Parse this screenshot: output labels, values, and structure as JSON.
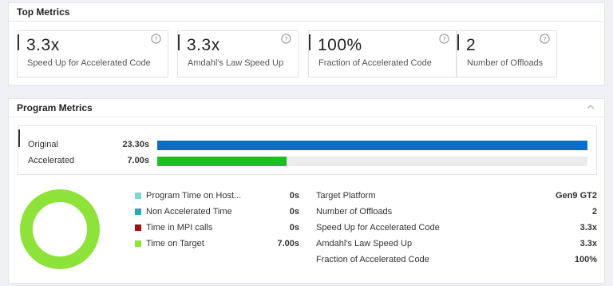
{
  "top_metrics": {
    "title": "Top Metrics",
    "cards": [
      {
        "value": "3.3x",
        "label": "Speed Up for Accelerated Code"
      },
      {
        "value": "3.3x",
        "label": "Amdahl's Law Speed Up"
      },
      {
        "value": "100%",
        "label": "Fraction of Accelerated Code"
      },
      {
        "value": "2",
        "label": "Number of Offloads"
      }
    ]
  },
  "program_metrics": {
    "title": "Program Metrics",
    "bars": [
      {
        "label": "Original",
        "value": "23.30s",
        "seconds": 23.3,
        "color": "#0a6ec8"
      },
      {
        "label": "Accelerated",
        "value": "7.00s",
        "seconds": 7.0,
        "color": "#19c01e"
      }
    ],
    "legend": [
      {
        "label": "Program Time on Host...",
        "value": "0s",
        "color": "#7fd6cc"
      },
      {
        "label": "Non Accelerated Time",
        "value": "0s",
        "color": "#26a7b4"
      },
      {
        "label": "Time in MPI calls",
        "value": "0s",
        "color": "#a30e0e"
      },
      {
        "label": "Time on Target",
        "value": "7.00s",
        "color": "#8ee33a"
      }
    ],
    "info": [
      {
        "label": "Target Platform",
        "value": "Gen9 GT2"
      },
      {
        "label": "Number of Offloads",
        "value": "2"
      },
      {
        "label": "Speed Up for Accelerated Code",
        "value": "3.3x"
      },
      {
        "label": "Amdahl's Law Speed Up",
        "value": "3.3x"
      },
      {
        "label": "Fraction of Accelerated Code",
        "value": "100%"
      }
    ],
    "donut_color": "#8ee33a"
  }
}
